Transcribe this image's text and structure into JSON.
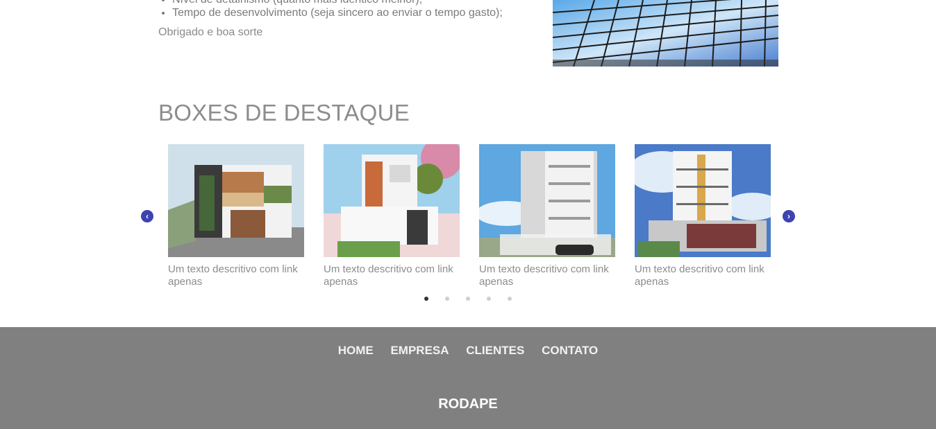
{
  "intro": {
    "bullets": [
      "Nível de detalhismo (quanto mais idêntico melhor);",
      "Tempo de desenvolvimento (seja sincero ao enviar o tempo gasto);"
    ],
    "closing": "Obrigado e boa sorte"
  },
  "highlights": {
    "title": "BOXES DE DESTAQUE",
    "prev_arrow": "‹",
    "next_arrow": "›",
    "cards": [
      {
        "text": "Um texto descritivo com link apenas"
      },
      {
        "text": "Um texto descritivo com link apenas"
      },
      {
        "text": "Um texto descritivo com link apenas"
      },
      {
        "text": "Um texto descritivo com link apenas"
      }
    ],
    "dots_total": 5,
    "active_dot": 1
  },
  "footer": {
    "nav": [
      "HOME",
      "EMPRESA",
      "CLIENTES",
      "CONTATO"
    ],
    "title": "RODAPE"
  },
  "colors": {
    "accent": "#3d43b0",
    "footer_bg": "#808080",
    "text_gray": "#8c8c8c"
  }
}
